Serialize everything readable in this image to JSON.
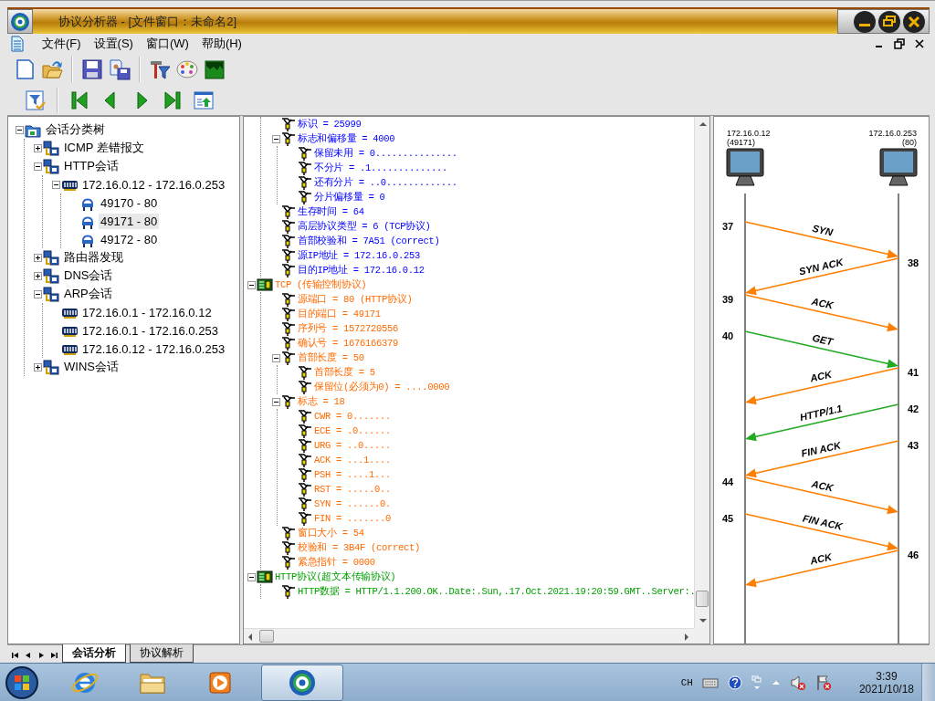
{
  "window": {
    "title": "协议分析器 - [文件窗口：未命名2]"
  },
  "menu": [
    "文件(F)",
    "设置(S)",
    "窗口(W)",
    "帮助(H)"
  ],
  "session_tree": [
    {
      "label": "会话分类树",
      "kind": "folder",
      "expanded": true,
      "selected": false,
      "children": [
        {
          "label": "ICMP 差错报文",
          "kind": "network",
          "expanded": false,
          "selected": false
        },
        {
          "label": "HTTP会话",
          "kind": "network",
          "expanded": true,
          "selected": false,
          "children": [
            {
              "label": "172.16.0.12 - 172.16.0.253",
              "kind": "nic",
              "expanded": true,
              "selected": false,
              "children": [
                {
                  "label": "49170 - 80",
                  "kind": "plug",
                  "selected": false
                },
                {
                  "label": "49171 - 80",
                  "kind": "plug",
                  "selected": true
                },
                {
                  "label": "49172 - 80",
                  "kind": "plug",
                  "selected": false
                }
              ]
            }
          ]
        },
        {
          "label": "路由器发现",
          "kind": "network",
          "expanded": false,
          "selected": false
        },
        {
          "label": "DNS会话",
          "kind": "network",
          "expanded": false,
          "selected": false
        },
        {
          "label": "ARP会话",
          "kind": "network",
          "expanded": true,
          "selected": false,
          "children": [
            {
              "label": "172.16.0.1 - 172.16.0.12",
              "kind": "nic",
              "selected": false
            },
            {
              "label": "172.16.0.1 - 172.16.0.253",
              "kind": "nic",
              "selected": false
            },
            {
              "label": "172.16.0.12 - 172.16.0.253",
              "kind": "nic",
              "selected": false
            }
          ]
        },
        {
          "label": "WINS会话",
          "kind": "network",
          "expanded": false,
          "selected": false
        }
      ]
    }
  ],
  "detail_tree": [
    {
      "kind": "network",
      "children": [
        {
          "label": "标识 = 25999"
        },
        {
          "label": "标志和偏移量 = 4000",
          "expanded": true,
          "children": [
            {
              "label": "保留未用 = 0..............."
            },
            {
              "label": "不分片 = .1.............."
            },
            {
              "label": "还有分片 = ..0............."
            },
            {
              "label": "分片偏移量 = 0"
            }
          ]
        },
        {
          "label": "生存时间 = 64"
        },
        {
          "label": "高层协议类型 = 6 (TCP协议)"
        },
        {
          "label": "首部校验和 = 7A51 (correct)"
        },
        {
          "label": "源IP地址 = 172.16.0.253"
        },
        {
          "label": "目的IP地址 = 172.16.0.12"
        }
      ]
    },
    {
      "kind": "transport",
      "label": "TCP (传输控制协议)",
      "expanded": true,
      "children": [
        {
          "label": "源端口 = 80 (HTTP协议)"
        },
        {
          "label": "目的端口 = 49171"
        },
        {
          "label": "序列号 = 1572720556"
        },
        {
          "label": "确认号 = 1676166379"
        },
        {
          "label": "首部长度 = 50",
          "expanded": true,
          "children": [
            {
              "label": "首部长度 = 5"
            },
            {
              "label": "保留位(必须为0) = ....0000"
            }
          ]
        },
        {
          "label": "标志 = 18",
          "expanded": true,
          "children": [
            {
              "label": "CWR = 0......."
            },
            {
              "label": "ECE = .0......"
            },
            {
              "label": "URG = ..0....."
            },
            {
              "label": "ACK = ...1...."
            },
            {
              "label": "PSH = ....1..."
            },
            {
              "label": "RST = .....0.."
            },
            {
              "label": "SYN = ......0."
            },
            {
              "label": "FIN = .......0"
            }
          ]
        },
        {
          "label": "窗口大小 = 54"
        },
        {
          "label": "校验和 = 3B4F (correct)"
        },
        {
          "label": "紧急指针 = 0000"
        }
      ]
    },
    {
      "kind": "application",
      "label": "HTTP协议(超文本传输协议)",
      "expanded": true,
      "children": [
        {
          "label": "HTTP数据 = HTTP/1.1.200.OK..Date:.Sun,.17.Oct.2021.19:20:59.GMT..Server:."
        }
      ]
    }
  ],
  "sequence": {
    "hosts": [
      {
        "address": "172.16.0.12",
        "port": "(49171)"
      },
      {
        "address": "172.16.0.253",
        "port": "(80)"
      }
    ],
    "messages": [
      {
        "number": "37",
        "label": "SYN",
        "leftward": false,
        "color": "#ff7f00"
      },
      {
        "number": "38",
        "label": "SYN ACK",
        "leftward": true,
        "color": "#ff7f00"
      },
      {
        "number": "39",
        "label": "ACK",
        "leftward": false,
        "color": "#ff7f00"
      },
      {
        "number": "40",
        "label": "GET",
        "leftward": false,
        "color": "#22aa22"
      },
      {
        "number": "41",
        "label": "ACK",
        "leftward": true,
        "color": "#ff7f00"
      },
      {
        "number": "42",
        "label": "HTTP/1.1",
        "leftward": true,
        "color": "#22aa22"
      },
      {
        "number": "43",
        "label": "FIN ACK",
        "leftward": true,
        "color": "#ff7f00"
      },
      {
        "number": "44",
        "label": "ACK",
        "leftward": false,
        "color": "#ff7f00"
      },
      {
        "number": "45",
        "label": "FIN ACK",
        "leftward": false,
        "color": "#ff7f00"
      },
      {
        "number": "46",
        "label": "ACK",
        "leftward": true,
        "color": "#ff7f00"
      }
    ]
  },
  "bottom_tabs": [
    {
      "label": "会话分析",
      "selected": true
    },
    {
      "label": "协议解析",
      "selected": false
    }
  ],
  "taskbar": {
    "apps": [
      {
        "kind": "browser",
        "selected": false
      },
      {
        "kind": "folder",
        "selected": false
      },
      {
        "kind": "media",
        "selected": false
      },
      {
        "kind": "analyzer",
        "selected": true
      }
    ]
  },
  "tray": {
    "language": "CH",
    "time": "3:39",
    "date": "2021/10/18"
  }
}
